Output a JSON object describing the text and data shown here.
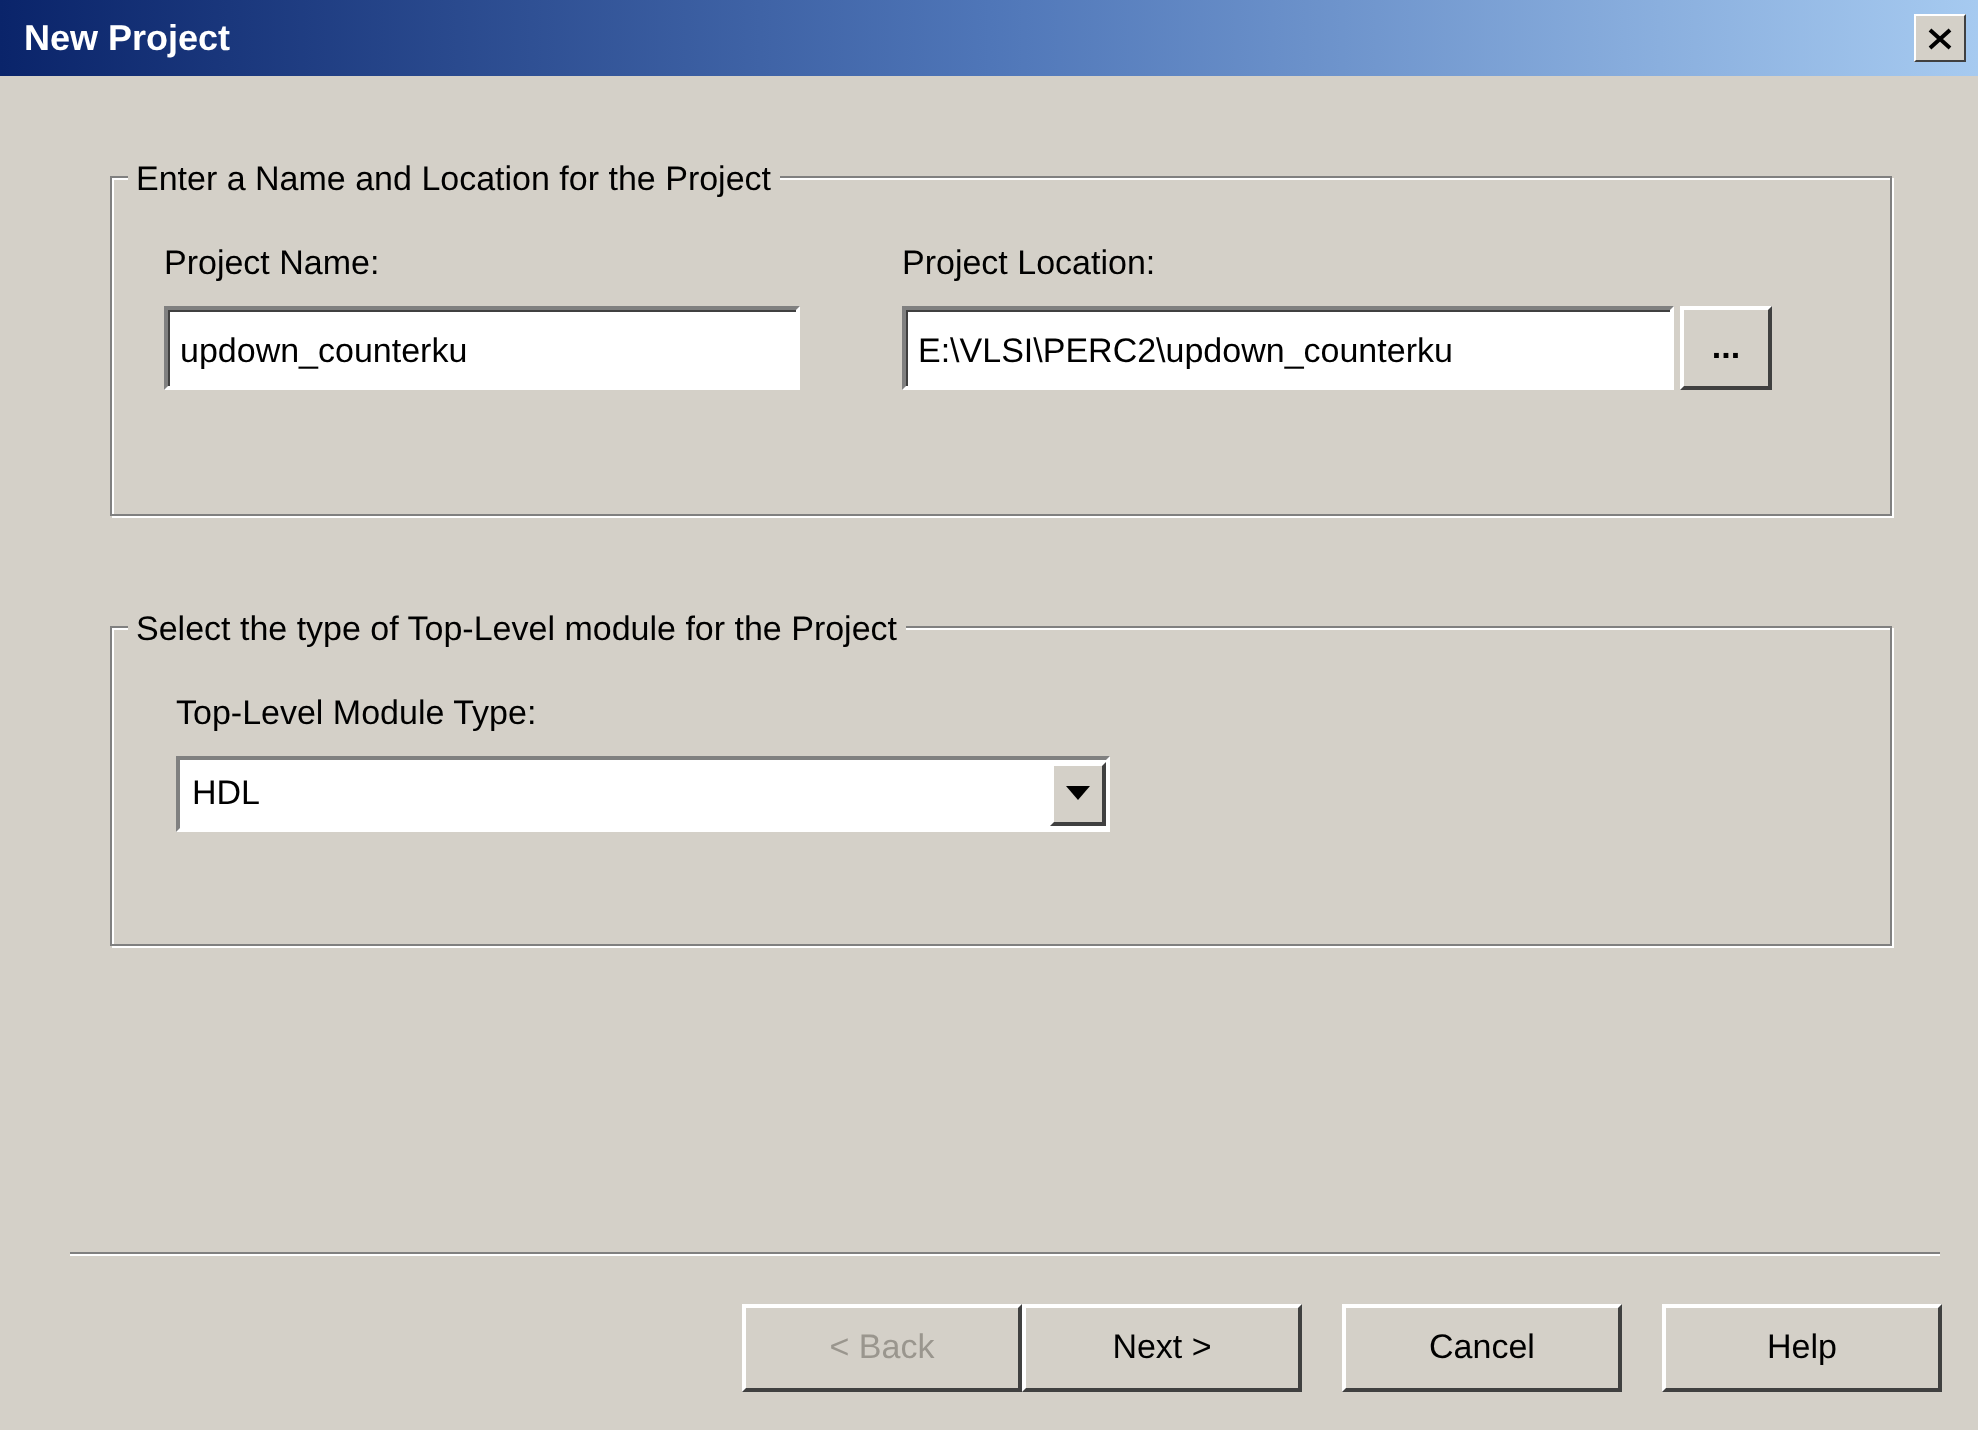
{
  "window": {
    "title": "New Project"
  },
  "groups": [
    {
      "kind": "location",
      "legend": "Enter a Name and Location for the Project",
      "fields": [
        {
          "label": "Project Name:",
          "value": "updown_counterku"
        },
        {
          "label": "Project Location:",
          "value": "E:\\VLSI\\PERC2\\updown_counterku",
          "browse": "..."
        }
      ]
    },
    {
      "kind": "module",
      "legend": "Select the type of Top-Level module for the Project",
      "fields": [
        {
          "label": "Top-Level Module Type:",
          "value": "HDL"
        }
      ]
    }
  ],
  "buttons": [
    {
      "label": "< Back",
      "disabled": true
    },
    {
      "label": "Next >",
      "disabled": false
    },
    {
      "label": "Cancel",
      "disabled": false
    },
    {
      "label": "Help",
      "disabled": false
    }
  ]
}
